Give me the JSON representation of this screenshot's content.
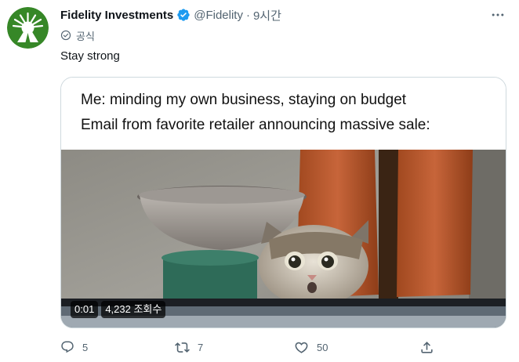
{
  "author": {
    "display_name": "Fidelity Investments",
    "handle": "@Fidelity",
    "separator": "·",
    "time": "9시간",
    "official_label": "공식",
    "avatar_icon": "fidelity-logo-icon",
    "brand_color": "#368727"
  },
  "tweet": {
    "text": "Stay strong"
  },
  "media": {
    "caption_line_1": "Me: minding my own business, staying on budget",
    "caption_line_2": "Email from favorite retailer announcing massive sale:",
    "video_time": "0:01",
    "view_count": "4,232 조회수"
  },
  "actions": {
    "reply_count": "5",
    "retweet_count": "7",
    "like_count": "50"
  },
  "colors": {
    "verified": "#1d9bf0",
    "muted": "#536471",
    "text": "#0f1419"
  }
}
